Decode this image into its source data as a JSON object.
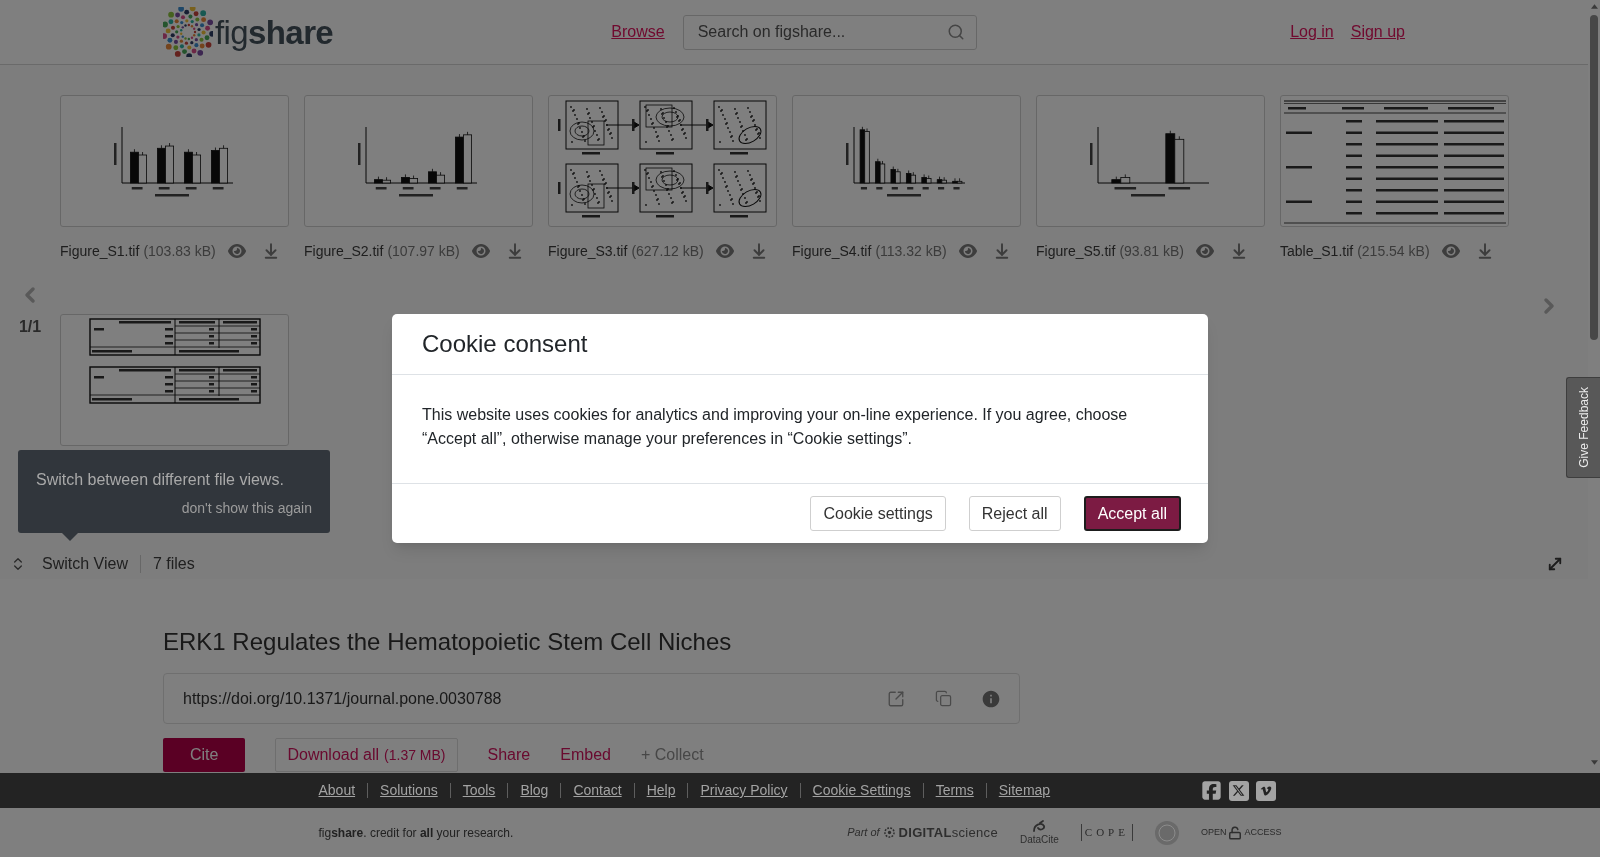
{
  "header": {
    "logo": "fig**share**",
    "nav_link": "Browse",
    "search": {
      "placeholder": "Search on figshare..."
    },
    "auth_links": [
      "Log in",
      "Sign up"
    ]
  },
  "file_viewer": {
    "files": [
      {
        "name": "Figure_S1.tif",
        "size": "(103.83 kB)",
        "kind": "bars"
      },
      {
        "name": "Figure_S2.tif",
        "size": "(107.97 kB)",
        "kind": "bars"
      },
      {
        "name": "Figure_S3.tif",
        "size": "(627.12 kB)",
        "kind": "cytometry"
      },
      {
        "name": "Figure_S4.tif",
        "size": "(113.32 kB)",
        "kind": "bars"
      },
      {
        "name": "Figure_S5.tif",
        "size": "(93.81 kB)",
        "kind": "bars"
      },
      {
        "name": "Table_S1.tif",
        "size": "(215.54 kB)",
        "kind": "table"
      },
      {
        "kind": "tables"
      }
    ],
    "page_indicator": "1/1",
    "tooltip": {
      "text": "Switch between different file views.",
      "dismiss": "don't show this again"
    },
    "switch_view": "Switch View",
    "file_count": "7 files"
  },
  "cookie_dialog": {
    "title": "Cookie consent",
    "message": "This website uses cookies for analytics and improving your on-line experience. If you agree, choose “Accept all”, otherwise manage your preferences in “Cookie settings”.",
    "buttons": [
      {
        "label": "Cookie settings",
        "kind": "secondary"
      },
      {
        "label": "Reject all",
        "kind": "secondary"
      },
      {
        "label": "Accept all",
        "kind": "primary"
      }
    ]
  },
  "article": {
    "title": "ERK1 Regulates the Hematopoietic Stem Cell Niches",
    "doi": "https://doi.org/10.1371/journal.pone.0030788",
    "actions": [
      {
        "label": "Cite",
        "kind": "primary"
      },
      {
        "label": "Download all",
        "detail": "(1.37 MB)",
        "kind": "outline"
      },
      {
        "label": "Share",
        "kind": "link"
      },
      {
        "label": "Embed",
        "kind": "link"
      },
      {
        "label": "+ Collect",
        "kind": "muted"
      }
    ]
  },
  "footer": {
    "links": [
      "About",
      "Solutions",
      "Tools",
      "Blog",
      "Contact",
      "Help",
      "Privacy Policy",
      "Cookie Settings",
      "Terms",
      "Sitemap"
    ],
    "tagline": "fig**share**. credit for **all** your research.",
    "partners": [
      {
        "kind": "digital_science",
        "parts": [
          "Part of",
          "**DIGITAL**science"
        ]
      },
      {
        "kind": "datacite",
        "parts": [
          "DataCite"
        ]
      },
      {
        "kind": "cope",
        "parts": [
          "COPE"
        ]
      },
      {
        "kind": "seal"
      },
      {
        "kind": "open_access",
        "parts": [
          "OPEN",
          "ACCESS"
        ]
      }
    ]
  },
  "feedback_tab": "Give Feedback"
}
